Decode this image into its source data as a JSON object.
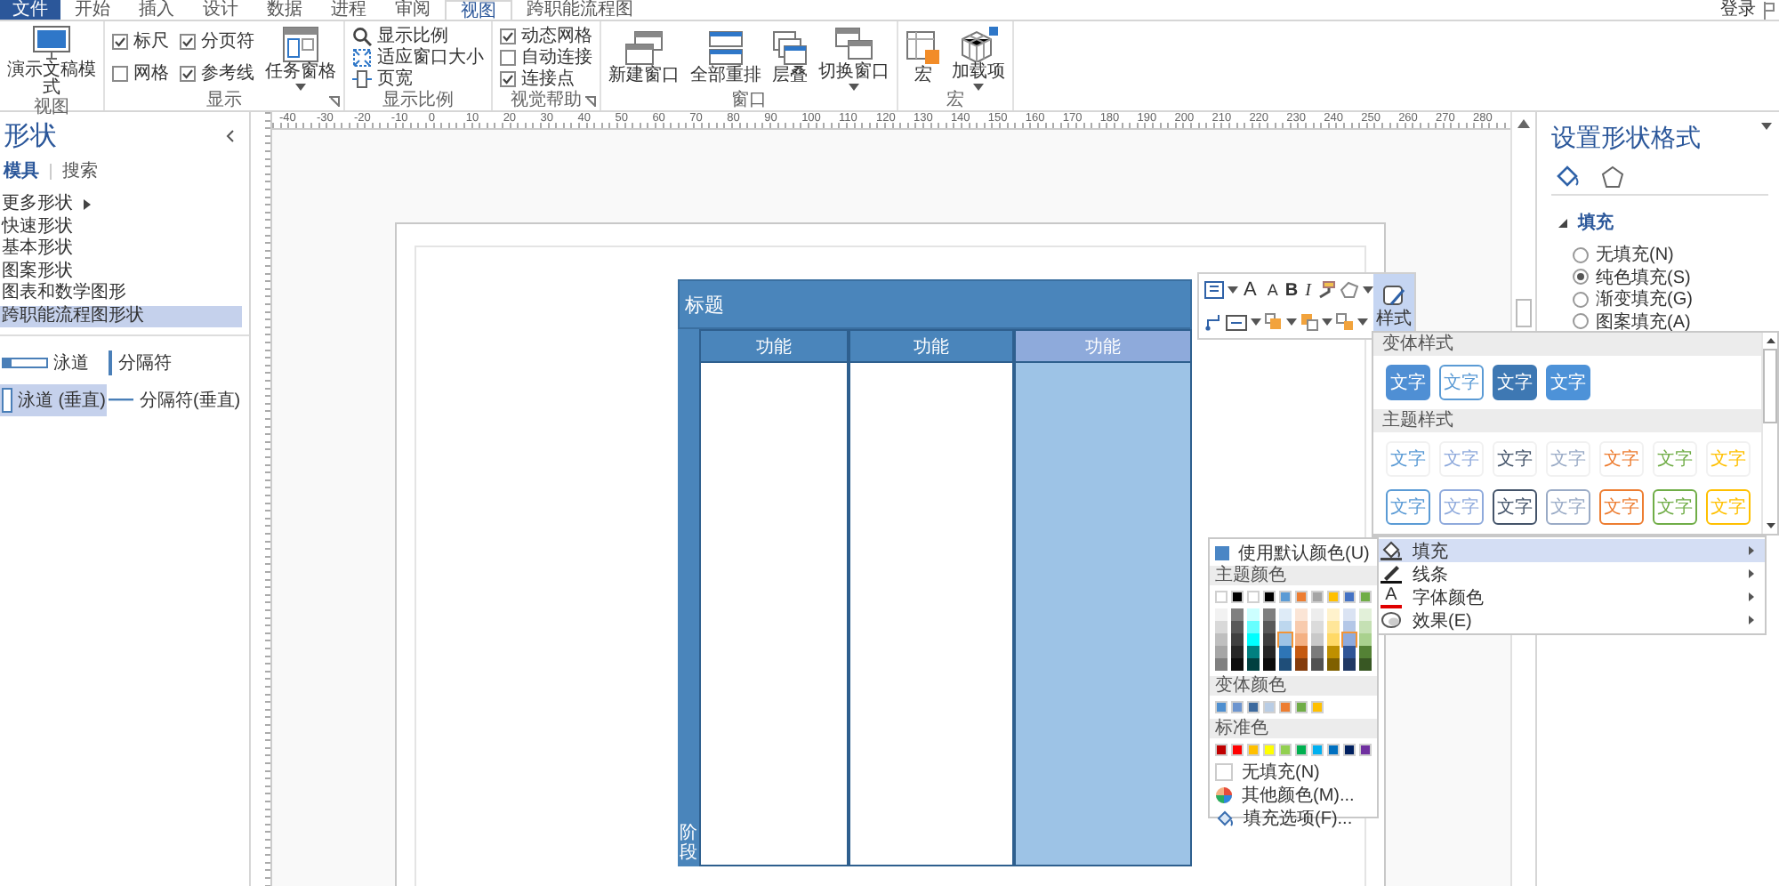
{
  "ribbon_tabs": [
    {
      "label": "文件",
      "kind": "file",
      "selected": false
    },
    {
      "label": "开始",
      "kind": "tab",
      "selected": false
    },
    {
      "label": "插入",
      "kind": "tab",
      "selected": false
    },
    {
      "label": "设计",
      "kind": "tab",
      "selected": false
    },
    {
      "label": "数据",
      "kind": "tab",
      "selected": false
    },
    {
      "label": "进程",
      "kind": "tab",
      "selected": false
    },
    {
      "label": "审阅",
      "kind": "tab",
      "selected": false
    },
    {
      "label": "视图",
      "kind": "tab",
      "selected": true
    },
    {
      "label": "跨职能流程图",
      "kind": "tab",
      "selected": false
    }
  ],
  "account": {
    "label": "登录"
  },
  "ribbon_groups": [
    {
      "label": "视图",
      "launcher": false,
      "controls": [
        {
          "kind": "large",
          "label": "演示文稿模式",
          "dropdown": false
        }
      ]
    },
    {
      "label": "显示",
      "launcher": true,
      "controls": [
        {
          "kind": "check",
          "label": "标尺",
          "checked": true
        },
        {
          "kind": "check",
          "label": "网格",
          "checked": false
        },
        {
          "kind": "check",
          "label": "分页符",
          "checked": true
        },
        {
          "kind": "check",
          "label": "参考线",
          "checked": true
        },
        {
          "kind": "large",
          "label": "任务窗格",
          "dropdown": true
        }
      ]
    },
    {
      "label": "显示比例",
      "launcher": false,
      "controls": [
        {
          "kind": "small",
          "label": "显示比例"
        },
        {
          "kind": "small",
          "label": "适应窗口大小"
        },
        {
          "kind": "small",
          "label": "页宽"
        }
      ]
    },
    {
      "label": "视觉帮助",
      "launcher": true,
      "controls": [
        {
          "kind": "check",
          "label": "动态网格",
          "checked": true
        },
        {
          "kind": "check",
          "label": "自动连接",
          "checked": false
        },
        {
          "kind": "check",
          "label": "连接点",
          "checked": true
        }
      ]
    },
    {
      "label": "窗口",
      "launcher": false,
      "controls": [
        {
          "kind": "large",
          "label": "新建窗口",
          "dropdown": false
        },
        {
          "kind": "large",
          "label": "全部重排",
          "dropdown": false
        },
        {
          "kind": "large",
          "label": "层叠",
          "dropdown": false
        },
        {
          "kind": "large",
          "label": "切换窗口",
          "dropdown": true
        }
      ]
    },
    {
      "label": "宏",
      "launcher": false,
      "controls": [
        {
          "kind": "large",
          "label": "宏",
          "dropdown": false
        },
        {
          "kind": "large",
          "label": "加载项",
          "dropdown": true
        }
      ]
    }
  ],
  "shapes_panel": {
    "title": "形状",
    "tabs": [
      {
        "label": "模具",
        "selected": true
      },
      {
        "label": "搜索",
        "selected": false
      }
    ],
    "categories": [
      {
        "label": "更多形状",
        "submenu": true,
        "selected": false
      },
      {
        "label": "快速形状",
        "submenu": false,
        "selected": false
      },
      {
        "label": "基本形状",
        "submenu": false,
        "selected": false
      },
      {
        "label": "图案形状",
        "submenu": false,
        "selected": false
      },
      {
        "label": "图表和数学图形",
        "submenu": false,
        "selected": false
      },
      {
        "label": "跨职能流程图形状",
        "submenu": false,
        "selected": true
      }
    ],
    "stencil": [
      {
        "label": "泳道",
        "selected": false
      },
      {
        "label": "分隔符",
        "selected": false
      },
      {
        "label": "泳道 (垂直)",
        "selected": true
      },
      {
        "label": "分隔符(垂直)",
        "selected": false
      }
    ]
  },
  "ruler": {
    "labels": [
      "-40",
      "-30",
      "-20",
      "-10",
      "0",
      "10",
      "20",
      "30",
      "40",
      "50",
      "60",
      "70",
      "80",
      "90",
      "100",
      "110",
      "120",
      "130",
      "140",
      "150",
      "160",
      "170",
      "180",
      "190",
      "200",
      "210",
      "220",
      "230",
      "240",
      "250",
      "260",
      "270",
      "280"
    ]
  },
  "diagram": {
    "title": "标题",
    "phase": "阶段",
    "lanes": [
      {
        "label": "功能",
        "selected": false
      },
      {
        "label": "功能",
        "selected": false
      },
      {
        "label": "功能",
        "selected": true
      }
    ]
  },
  "mini_toolbar": {
    "font_buttons": [
      {
        "label": "A",
        "kind": "grow"
      },
      {
        "label": "A",
        "kind": "shrink"
      },
      {
        "label": "B",
        "kind": "bold"
      },
      {
        "label": "I",
        "kind": "italic"
      }
    ],
    "style_button": {
      "label": "样式",
      "on": true
    }
  },
  "style_gallery": {
    "sections": [
      {
        "title": "变体样式",
        "tiles": [
          {
            "label": "文字",
            "kind": "fill",
            "color": "#4f8fd4"
          },
          {
            "label": "文字",
            "kind": "outline",
            "color": "#5b9bd5"
          },
          {
            "label": "文字",
            "kind": "fill",
            "color": "#3e78b3"
          },
          {
            "label": "文字",
            "kind": "fill",
            "color": "#4d92d8"
          }
        ]
      },
      {
        "title": "主题样式",
        "tiles": [
          {
            "label": "文字",
            "kind": "plain",
            "color": "#5b9bd5"
          },
          {
            "label": "文字",
            "kind": "plain",
            "color": "#8faadc"
          },
          {
            "label": "文字",
            "kind": "plain",
            "color": "#44546a"
          },
          {
            "label": "文字",
            "kind": "plain",
            "color": "#9aabc6"
          },
          {
            "label": "文字",
            "kind": "plain",
            "color": "#ed7d31"
          },
          {
            "label": "文字",
            "kind": "plain",
            "color": "#70ad47"
          },
          {
            "label": "文字",
            "kind": "plain",
            "color": "#ffc000"
          },
          {
            "label": "文字",
            "kind": "outline",
            "color": "#5b9bd5"
          },
          {
            "label": "文字",
            "kind": "outline",
            "color": "#8faadc"
          },
          {
            "label": "文字",
            "kind": "outline",
            "color": "#44546a"
          },
          {
            "label": "文字",
            "kind": "outline",
            "color": "#9aabc6"
          },
          {
            "label": "文字",
            "kind": "outline",
            "color": "#ed7d31"
          },
          {
            "label": "文字",
            "kind": "outline",
            "color": "#70ad47"
          },
          {
            "label": "文字",
            "kind": "outline",
            "color": "#ffc000"
          }
        ]
      }
    ]
  },
  "format_menu": {
    "items": [
      {
        "label": "填充",
        "selected": true
      },
      {
        "label": "线条",
        "selected": false
      },
      {
        "label": "字体颜色",
        "selected": false,
        "glyph": "A"
      },
      {
        "label": "效果(E)",
        "selected": false
      }
    ]
  },
  "color_menu": {
    "default": {
      "label": "使用默认颜色(U)",
      "color": "#4a86c5"
    },
    "theme_header": "主题颜色",
    "theme_columns": [
      {
        "color": "#ffffff",
        "selected": false,
        "shades": [
          {
            "color": "#f2f2f2",
            "selected": false
          },
          {
            "color": "#d9d9d9",
            "selected": false
          },
          {
            "color": "#bfbfbf",
            "selected": false
          },
          {
            "color": "#a6a6a6",
            "selected": false
          },
          {
            "color": "#808080",
            "selected": false
          }
        ]
      },
      {
        "color": "#000000",
        "selected": false,
        "shades": [
          {
            "color": "#808080",
            "selected": false
          },
          {
            "color": "#595959",
            "selected": false
          },
          {
            "color": "#404040",
            "selected": false
          },
          {
            "color": "#262626",
            "selected": false
          },
          {
            "color": "#0d0d0d",
            "selected": false
          }
        ]
      },
      {
        "color": "#ffffff",
        "selected": false,
        "shades": [
          {
            "color": "#ccffff",
            "selected": false
          },
          {
            "color": "#66ffff",
            "selected": false
          },
          {
            "color": "#00ffff",
            "selected": false
          },
          {
            "color": "#008080",
            "selected": false
          },
          {
            "color": "#004040",
            "selected": false
          }
        ]
      },
      {
        "color": "#000000",
        "selected": false,
        "shades": [
          {
            "color": "#7f7f7f",
            "selected": false
          },
          {
            "color": "#595959",
            "selected": false
          },
          {
            "color": "#3f3f3f",
            "selected": false
          },
          {
            "color": "#262626",
            "selected": false
          },
          {
            "color": "#0c0c0c",
            "selected": false
          }
        ]
      },
      {
        "color": "#5b9bd5",
        "selected": false,
        "shades": [
          {
            "color": "#deebf7",
            "selected": false
          },
          {
            "color": "#bdd7ee",
            "selected": false
          },
          {
            "color": "#9dc3e6",
            "selected": true
          },
          {
            "color": "#2e75b6",
            "selected": false
          },
          {
            "color": "#1f4e79",
            "selected": false
          }
        ]
      },
      {
        "color": "#ed7d31",
        "selected": false,
        "shades": [
          {
            "color": "#fbe5d6",
            "selected": false
          },
          {
            "color": "#f8cbad",
            "selected": false
          },
          {
            "color": "#f4b183",
            "selected": false
          },
          {
            "color": "#c55a11",
            "selected": false
          },
          {
            "color": "#843c0c",
            "selected": false
          }
        ]
      },
      {
        "color": "#a5a5a5",
        "selected": false,
        "shades": [
          {
            "color": "#ededed",
            "selected": false
          },
          {
            "color": "#dbdbdb",
            "selected": false
          },
          {
            "color": "#c9c9c9",
            "selected": false
          },
          {
            "color": "#7b7b7b",
            "selected": false
          },
          {
            "color": "#525252",
            "selected": false
          }
        ]
      },
      {
        "color": "#ffc000",
        "selected": false,
        "shades": [
          {
            "color": "#fff2cc",
            "selected": false
          },
          {
            "color": "#ffe699",
            "selected": false
          },
          {
            "color": "#ffd966",
            "selected": false
          },
          {
            "color": "#bf9000",
            "selected": false
          },
          {
            "color": "#7f6000",
            "selected": false
          }
        ]
      },
      {
        "color": "#4472c4",
        "selected": false,
        "shades": [
          {
            "color": "#dae3f3",
            "selected": false
          },
          {
            "color": "#b4c7e7",
            "selected": false
          },
          {
            "color": "#8faadc",
            "selected": true
          },
          {
            "color": "#2f5597",
            "selected": false
          },
          {
            "color": "#203864",
            "selected": false
          }
        ]
      },
      {
        "color": "#70ad47",
        "selected": false,
        "shades": [
          {
            "color": "#e2f0d9",
            "selected": false
          },
          {
            "color": "#c5e0b4",
            "selected": false
          },
          {
            "color": "#a9d18e",
            "selected": false
          },
          {
            "color": "#548235",
            "selected": false
          },
          {
            "color": "#385723",
            "selected": false
          }
        ]
      }
    ],
    "variant_header": "变体颜色",
    "variant_colors": [
      {
        "color": "#4e8fd0"
      },
      {
        "color": "#6d95cf"
      },
      {
        "color": "#3d6a9e"
      },
      {
        "color": "#b9cde5"
      },
      {
        "color": "#ed7d31"
      },
      {
        "color": "#70ad47"
      },
      {
        "color": "#ffc000"
      }
    ],
    "standard_header": "标准色",
    "standard_colors": [
      {
        "color": "#c00000"
      },
      {
        "color": "#ff0000"
      },
      {
        "color": "#ffc000"
      },
      {
        "color": "#ffff00"
      },
      {
        "color": "#92d050"
      },
      {
        "color": "#00b050"
      },
      {
        "color": "#00b0f0"
      },
      {
        "color": "#0070c0"
      },
      {
        "color": "#002060"
      },
      {
        "color": "#7030a0"
      }
    ],
    "actions": [
      {
        "label": "无填充(N)",
        "kind": "none"
      },
      {
        "label": "其他颜色(M)...",
        "kind": "more"
      },
      {
        "label": "填充选项(F)...",
        "kind": "options"
      }
    ]
  },
  "format_panel": {
    "title": "设置形状格式",
    "section": {
      "label": "填充",
      "expanded": true
    },
    "options": [
      {
        "label": "无填充(N)",
        "selected": false
      },
      {
        "label": "纯色填充(S)",
        "selected": true
      },
      {
        "label": "渐变填充(G)",
        "selected": false
      },
      {
        "label": "图案填充(A)",
        "selected": false
      }
    ]
  }
}
